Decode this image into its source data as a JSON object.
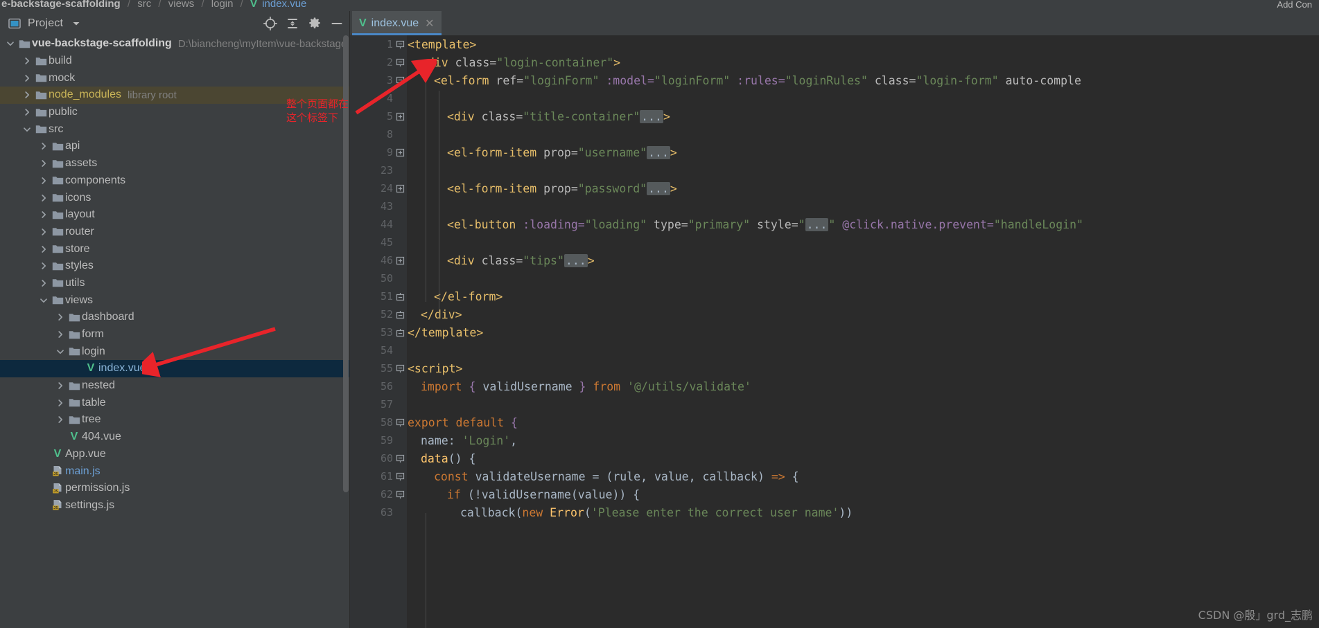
{
  "breadcrumb": {
    "project": "e-backstage-scaffolding",
    "parts": [
      "src",
      "views",
      "login"
    ],
    "file": "index.vue",
    "vue_icon": "vue-icon",
    "separator": "/"
  },
  "run_config": {
    "label": "Add Con"
  },
  "panel": {
    "title": "Project",
    "dropdown_icon": "chevron-down-icon",
    "toolbar": [
      {
        "name": "locate-icon",
        "glyph": "target"
      },
      {
        "name": "collapse-all-icon",
        "glyph": "collapse"
      },
      {
        "name": "settings-icon",
        "glyph": "gear"
      },
      {
        "name": "hide-icon",
        "glyph": "minus"
      }
    ]
  },
  "tree": [
    {
      "label": "vue-backstage-scaffolding",
      "sub": "D:\\biancheng\\myItem\\vue-backstage",
      "depth": 0,
      "icon": "folder-icon",
      "state": "expanded",
      "style": "root"
    },
    {
      "label": "build",
      "depth": 1,
      "icon": "folder-icon",
      "state": "collapsed"
    },
    {
      "label": "mock",
      "depth": 1,
      "icon": "folder-icon",
      "state": "collapsed"
    },
    {
      "label": "node_modules",
      "sub": "library root",
      "depth": 1,
      "icon": "folder-icon",
      "state": "collapsed",
      "style": "highlighted"
    },
    {
      "label": "public",
      "depth": 1,
      "icon": "folder-icon",
      "state": "collapsed"
    },
    {
      "label": "src",
      "depth": 1,
      "icon": "folder-icon",
      "state": "expanded"
    },
    {
      "label": "api",
      "depth": 2,
      "icon": "folder-icon",
      "state": "collapsed"
    },
    {
      "label": "assets",
      "depth": 2,
      "icon": "folder-icon",
      "state": "collapsed"
    },
    {
      "label": "components",
      "depth": 2,
      "icon": "folder-icon",
      "state": "collapsed"
    },
    {
      "label": "icons",
      "depth": 2,
      "icon": "folder-icon",
      "state": "collapsed"
    },
    {
      "label": "layout",
      "depth": 2,
      "icon": "folder-icon",
      "state": "collapsed"
    },
    {
      "label": "router",
      "depth": 2,
      "icon": "folder-icon",
      "state": "collapsed"
    },
    {
      "label": "store",
      "depth": 2,
      "icon": "folder-icon",
      "state": "collapsed"
    },
    {
      "label": "styles",
      "depth": 2,
      "icon": "folder-icon",
      "state": "collapsed"
    },
    {
      "label": "utils",
      "depth": 2,
      "icon": "folder-icon",
      "state": "collapsed"
    },
    {
      "label": "views",
      "depth": 2,
      "icon": "folder-icon",
      "state": "expanded"
    },
    {
      "label": "dashboard",
      "depth": 3,
      "icon": "folder-icon",
      "state": "collapsed"
    },
    {
      "label": "form",
      "depth": 3,
      "icon": "folder-icon",
      "state": "collapsed"
    },
    {
      "label": "login",
      "depth": 3,
      "icon": "folder-icon",
      "state": "expanded"
    },
    {
      "label": "index.vue",
      "depth": 4,
      "icon": "vue-icon",
      "state": "leaf",
      "style": "selected"
    },
    {
      "label": "nested",
      "depth": 3,
      "icon": "folder-icon",
      "state": "collapsed"
    },
    {
      "label": "table",
      "depth": 3,
      "icon": "folder-icon",
      "state": "collapsed"
    },
    {
      "label": "tree",
      "depth": 3,
      "icon": "folder-icon",
      "state": "collapsed"
    },
    {
      "label": "404.vue",
      "depth": 3,
      "icon": "vue-icon",
      "state": "leaf"
    },
    {
      "label": "App.vue",
      "depth": 2,
      "icon": "vue-icon",
      "state": "leaf"
    },
    {
      "label": "main.js",
      "depth": 2,
      "icon": "js-icon",
      "state": "leaf",
      "style": "modified"
    },
    {
      "label": "permission.js",
      "depth": 2,
      "icon": "js-icon",
      "state": "leaf"
    },
    {
      "label": "settings.js",
      "depth": 2,
      "icon": "js-icon",
      "state": "leaf"
    }
  ],
  "editor": {
    "tab": {
      "label": "index.vue",
      "icon": "vue-icon",
      "close_icon": "close-icon",
      "active": true
    },
    "lines": [
      {
        "no": "1",
        "fold": "expanded",
        "indent": 0,
        "tokens": [
          {
            "t": "<template>",
            "c": "tg"
          }
        ]
      },
      {
        "no": "2",
        "fold": "expanded",
        "indent": 1,
        "tokens": [
          {
            "t": "<div ",
            "c": "tg"
          },
          {
            "t": "class=",
            "c": "at"
          },
          {
            "t": "\"login-container\"",
            "c": "st"
          },
          {
            "t": ">",
            "c": "tg"
          }
        ]
      },
      {
        "no": "3",
        "fold": "expanded",
        "indent": 2,
        "tokens": [
          {
            "t": "<el-form ",
            "c": "tg"
          },
          {
            "t": "ref=",
            "c": "at"
          },
          {
            "t": "\"loginForm\"",
            "c": "st"
          },
          {
            "t": " ",
            "c": "at"
          },
          {
            "t": ":model=",
            "c": "pp"
          },
          {
            "t": "\"loginForm\"",
            "c": "st"
          },
          {
            "t": " ",
            "c": "at"
          },
          {
            "t": ":rules=",
            "c": "pp"
          },
          {
            "t": "\"loginRules\"",
            "c": "st"
          },
          {
            "t": " ",
            "c": "at"
          },
          {
            "t": "class=",
            "c": "at"
          },
          {
            "t": "\"login-form\"",
            "c": "st"
          },
          {
            "t": " auto-comple",
            "c": "at"
          }
        ]
      },
      {
        "no": "4",
        "fold": "none",
        "indent": 0,
        "tokens": []
      },
      {
        "no": "5",
        "fold": "collapsed",
        "indent": 3,
        "tokens": [
          {
            "t": "<div ",
            "c": "tg"
          },
          {
            "t": "class=",
            "c": "at"
          },
          {
            "t": "\"title-container\"",
            "c": "st"
          },
          {
            "t": "...",
            "c": "fold-ph"
          },
          {
            "t": ">",
            "c": "tg"
          }
        ]
      },
      {
        "no": "8",
        "fold": "none",
        "indent": 0,
        "tokens": []
      },
      {
        "no": "9",
        "fold": "collapsed",
        "indent": 3,
        "tokens": [
          {
            "t": "<el-form-item ",
            "c": "tg"
          },
          {
            "t": "prop=",
            "c": "at"
          },
          {
            "t": "\"username\"",
            "c": "st"
          },
          {
            "t": "...",
            "c": "fold-ph"
          },
          {
            "t": ">",
            "c": "tg"
          }
        ]
      },
      {
        "no": "23",
        "fold": "none",
        "indent": 0,
        "tokens": []
      },
      {
        "no": "24",
        "fold": "collapsed",
        "indent": 3,
        "tokens": [
          {
            "t": "<el-form-item ",
            "c": "tg"
          },
          {
            "t": "prop=",
            "c": "at"
          },
          {
            "t": "\"password\"",
            "c": "st"
          },
          {
            "t": "...",
            "c": "fold-ph"
          },
          {
            "t": ">",
            "c": "tg"
          }
        ]
      },
      {
        "no": "43",
        "fold": "none",
        "indent": 0,
        "tokens": []
      },
      {
        "no": "44",
        "fold": "none",
        "indent": 3,
        "tokens": [
          {
            "t": "<el-button ",
            "c": "tg"
          },
          {
            "t": ":loading=",
            "c": "pp"
          },
          {
            "t": "\"loading\"",
            "c": "st"
          },
          {
            "t": " ",
            "c": "at"
          },
          {
            "t": "type=",
            "c": "at"
          },
          {
            "t": "\"primary\"",
            "c": "st"
          },
          {
            "t": " ",
            "c": "at"
          },
          {
            "t": "style=",
            "c": "at"
          },
          {
            "t": "\"",
            "c": "st"
          },
          {
            "t": "...",
            "c": "fold-ph"
          },
          {
            "t": "\"",
            "c": "st"
          },
          {
            "t": " ",
            "c": "at"
          },
          {
            "t": "@click.native.prevent=",
            "c": "pp"
          },
          {
            "t": "\"handleLogin\"",
            "c": "st"
          }
        ]
      },
      {
        "no": "45",
        "fold": "none",
        "indent": 0,
        "tokens": []
      },
      {
        "no": "46",
        "fold": "collapsed",
        "indent": 3,
        "tokens": [
          {
            "t": "<div ",
            "c": "tg"
          },
          {
            "t": "class=",
            "c": "at"
          },
          {
            "t": "\"tips\"",
            "c": "st"
          },
          {
            "t": "...",
            "c": "fold-ph"
          },
          {
            "t": ">",
            "c": "tg"
          }
        ]
      },
      {
        "no": "50",
        "fold": "none",
        "indent": 0,
        "tokens": []
      },
      {
        "no": "51",
        "fold": "end",
        "indent": 2,
        "tokens": [
          {
            "t": "</el-form>",
            "c": "tg"
          }
        ]
      },
      {
        "no": "52",
        "fold": "end",
        "indent": 1,
        "tokens": [
          {
            "t": "</div>",
            "c": "tg"
          }
        ]
      },
      {
        "no": "53",
        "fold": "end",
        "indent": 0,
        "tokens": [
          {
            "t": "</template>",
            "c": "tg"
          }
        ]
      },
      {
        "no": "54",
        "fold": "none",
        "indent": 0,
        "tokens": []
      },
      {
        "no": "55",
        "fold": "expanded",
        "indent": 0,
        "tokens": [
          {
            "t": "<script>",
            "c": "tg"
          }
        ]
      },
      {
        "no": "56",
        "fold": "none",
        "indent": 1,
        "tokens": [
          {
            "t": "import ",
            "c": "kw"
          },
          {
            "t": "{ ",
            "c": "pp"
          },
          {
            "t": "validUsername",
            "c": "id"
          },
          {
            "t": " }",
            "c": "pp"
          },
          {
            "t": " ",
            "c": "id"
          },
          {
            "t": "from ",
            "c": "kw"
          },
          {
            "t": "'@/utils/validate'",
            "c": "st"
          }
        ]
      },
      {
        "no": "57",
        "fold": "none",
        "indent": 0,
        "tokens": []
      },
      {
        "no": "58",
        "fold": "expanded",
        "indent": 0,
        "tokens": [
          {
            "t": "export default ",
            "c": "kw"
          },
          {
            "t": "{",
            "c": "pp"
          }
        ]
      },
      {
        "no": "59",
        "fold": "none",
        "indent": 1,
        "tokens": [
          {
            "t": "name",
            "c": "id"
          },
          {
            "t": ": ",
            "c": "id"
          },
          {
            "t": "'Login'",
            "c": "st"
          },
          {
            "t": ",",
            "c": "id"
          }
        ]
      },
      {
        "no": "60",
        "fold": "expanded",
        "indent": 1,
        "tokens": [
          {
            "t": "data",
            "c": "fn"
          },
          {
            "t": "() {",
            "c": "id"
          }
        ]
      },
      {
        "no": "61",
        "fold": "expanded",
        "indent": 2,
        "tokens": [
          {
            "t": "const ",
            "c": "kw"
          },
          {
            "t": "validateUsername",
            "c": "id"
          },
          {
            "t": " = (",
            "c": "id"
          },
          {
            "t": "rule",
            "c": "id"
          },
          {
            "t": ", ",
            "c": "id"
          },
          {
            "t": "value",
            "c": "id"
          },
          {
            "t": ", ",
            "c": "id"
          },
          {
            "t": "callback",
            "c": "id"
          },
          {
            "t": ") ",
            "c": "id"
          },
          {
            "t": "=> ",
            "c": "kw"
          },
          {
            "t": "{",
            "c": "id"
          }
        ]
      },
      {
        "no": "62",
        "fold": "expanded",
        "indent": 3,
        "tokens": [
          {
            "t": "if ",
            "c": "kw"
          },
          {
            "t": "(!",
            "c": "id"
          },
          {
            "t": "validUsername",
            "c": "id"
          },
          {
            "t": "(",
            "c": "id"
          },
          {
            "t": "value",
            "c": "id"
          },
          {
            "t": ")) {",
            "c": "id"
          }
        ]
      },
      {
        "no": "63",
        "fold": "none",
        "indent": 4,
        "tokens": [
          {
            "t": "callback",
            "c": "id"
          },
          {
            "t": "(",
            "c": "id"
          },
          {
            "t": "new ",
            "c": "kw"
          },
          {
            "t": "Error",
            "c": "fn"
          },
          {
            "t": "(",
            "c": "id"
          },
          {
            "t": "'Please enter the correct user name'",
            "c": "st"
          },
          {
            "t": "))",
            "c": "id"
          }
        ]
      }
    ]
  },
  "annotations": {
    "note_line1": "整个页面都在",
    "note_line2": "这个标签下",
    "arrows": [
      {
        "name": "arrow-to-div-tag"
      },
      {
        "name": "arrow-to-index-vue"
      }
    ]
  },
  "watermark": {
    "text": "CSDN @殷」grd_志鹏"
  },
  "colors": {
    "panel_bg": "#3c3f41",
    "editor_bg": "#2b2b2b",
    "gutter_bg": "#313335",
    "selection": "#0d293e",
    "highlight": "#4b4632",
    "accent": "#4a88c7",
    "tag": "#e8bf6a",
    "string": "#6a8759",
    "keyword": "#cc7832",
    "annotation": "#e8242a",
    "vue_green": "#4fc08d",
    "js_badge": "#c9a227"
  }
}
